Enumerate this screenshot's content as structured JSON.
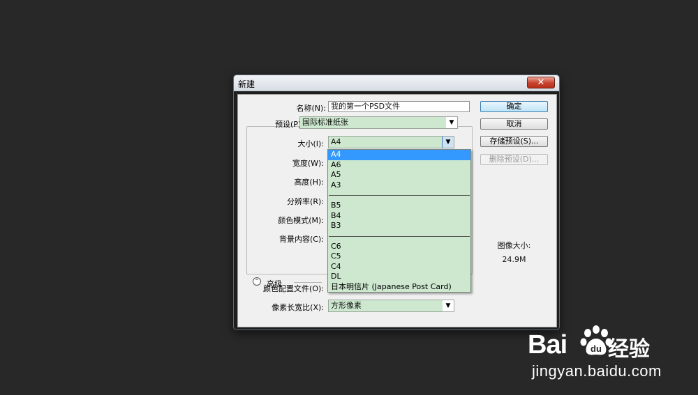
{
  "dialog": {
    "title": "新建",
    "close_label": "✕"
  },
  "form": {
    "name_label": "名称(N):",
    "name_value": "我的第一个PSD文件",
    "preset_label": "预设(P):",
    "preset_value": "国际标准纸张",
    "size_label": "大小(I):",
    "size_value": "A4",
    "width_label": "宽度(W):",
    "height_label": "高度(H):",
    "resolution_label": "分辨率(R):",
    "color_mode_label": "颜色模式(M):",
    "background_label": "背景内容(C):",
    "advanced_label": "高级",
    "color_profile_label": "颜色配置文件(O):",
    "pixel_aspect_label": "像素长宽比(X):",
    "pixel_aspect_value": "方形像素"
  },
  "buttons": {
    "ok": "确定",
    "cancel": "取消",
    "save_preset": "存储预设(S)...",
    "delete_preset": "删除预设(D)..."
  },
  "image_size": {
    "label": "图像大小:",
    "value": "24.9M"
  },
  "size_options": {
    "group_a": [
      "A4",
      "A6",
      "A5",
      "A3"
    ],
    "group_b": [
      "B5",
      "B4",
      "B3"
    ],
    "group_c": [
      "C6",
      "C5",
      "C4",
      "DL",
      "日本明信片 (Japanese Post Card)"
    ],
    "selected": "A4"
  },
  "watermark": {
    "logo_text": "Bai",
    "logo_text2": "经验",
    "url": "jingyan.baidu.com"
  },
  "colors": {
    "background": "#282828",
    "combo_fill": "#cde8cf",
    "selection": "#3399ff"
  }
}
